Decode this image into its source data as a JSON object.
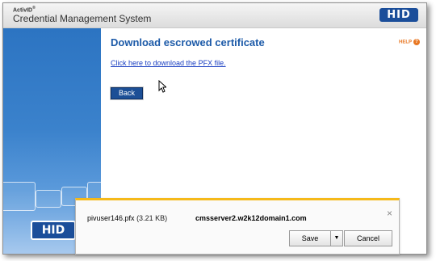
{
  "header": {
    "brand": "ActivID",
    "brand_mark": "®",
    "app_title": "Credential Management System",
    "logo_text": "HID"
  },
  "sidebar": {
    "logo_text": "HID"
  },
  "main": {
    "title": "Download escrowed certificate",
    "help_label": "HELP",
    "help_icon": "?",
    "download_link": "Click here to download the PFX file.",
    "back_button": "Back"
  },
  "download_bar": {
    "file_name": "pivuser146.pfx",
    "file_size": "(3.21 KB)",
    "host": "cmsserver2.w2k12domain1.com",
    "close_icon": "×",
    "save_label": "Save",
    "dropdown_icon": "▼",
    "cancel_label": "Cancel",
    "accent_color": "#f5b91a"
  },
  "colors": {
    "brand_blue": "#1b4e9a",
    "title_blue": "#1c5aa8",
    "link_blue": "#1a3fc2",
    "help_orange": "#e87722"
  }
}
